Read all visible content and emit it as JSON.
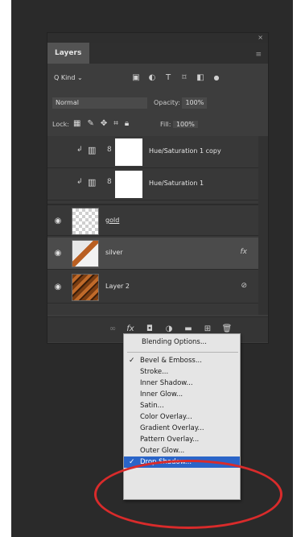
{
  "panel": {
    "tab_label": "Layers",
    "menu_icon": "≡",
    "close_icon": "×"
  },
  "filter": {
    "kind_label": "Q Kind",
    "kind_caret": "⌄"
  },
  "blend": {
    "mode": "Normal",
    "opacity_label": "Opacity:",
    "opacity_value": "100%"
  },
  "lock": {
    "label": "Lock:",
    "fill_label": "Fill:",
    "fill_value": "100%"
  },
  "layers": [
    {
      "name": "Hue/Saturation 1 copy",
      "type": "adjustment"
    },
    {
      "name": "Hue/Saturation 1",
      "type": "adjustment"
    },
    {
      "name": "gold",
      "type": "pixel"
    },
    {
      "name": "silver",
      "type": "pixel",
      "selected": true,
      "badge": "fx"
    },
    {
      "name": "Layer 2",
      "type": "smart",
      "badge": "⊘"
    }
  ],
  "menu": {
    "items": [
      {
        "label": "Blending Options...",
        "checked": false
      },
      {
        "label": "Bevel & Emboss...",
        "checked": true
      },
      {
        "label": "Stroke...",
        "checked": false
      },
      {
        "label": "Inner Shadow...",
        "checked": false
      },
      {
        "label": "Inner Glow...",
        "checked": false
      },
      {
        "label": "Satin...",
        "checked": false
      },
      {
        "label": "Color Overlay...",
        "checked": false
      },
      {
        "label": "Gradient Overlay...",
        "checked": false
      },
      {
        "label": "Pattern Overlay...",
        "checked": false
      },
      {
        "label": "Outer Glow...",
        "checked": false
      },
      {
        "label": "Drop Shadow...",
        "checked": true,
        "highlighted": true
      }
    ],
    "check_glyph": "✓"
  },
  "colors": {
    "highlight": "#2a64c8",
    "annotation_circle": "#d92b2b"
  }
}
